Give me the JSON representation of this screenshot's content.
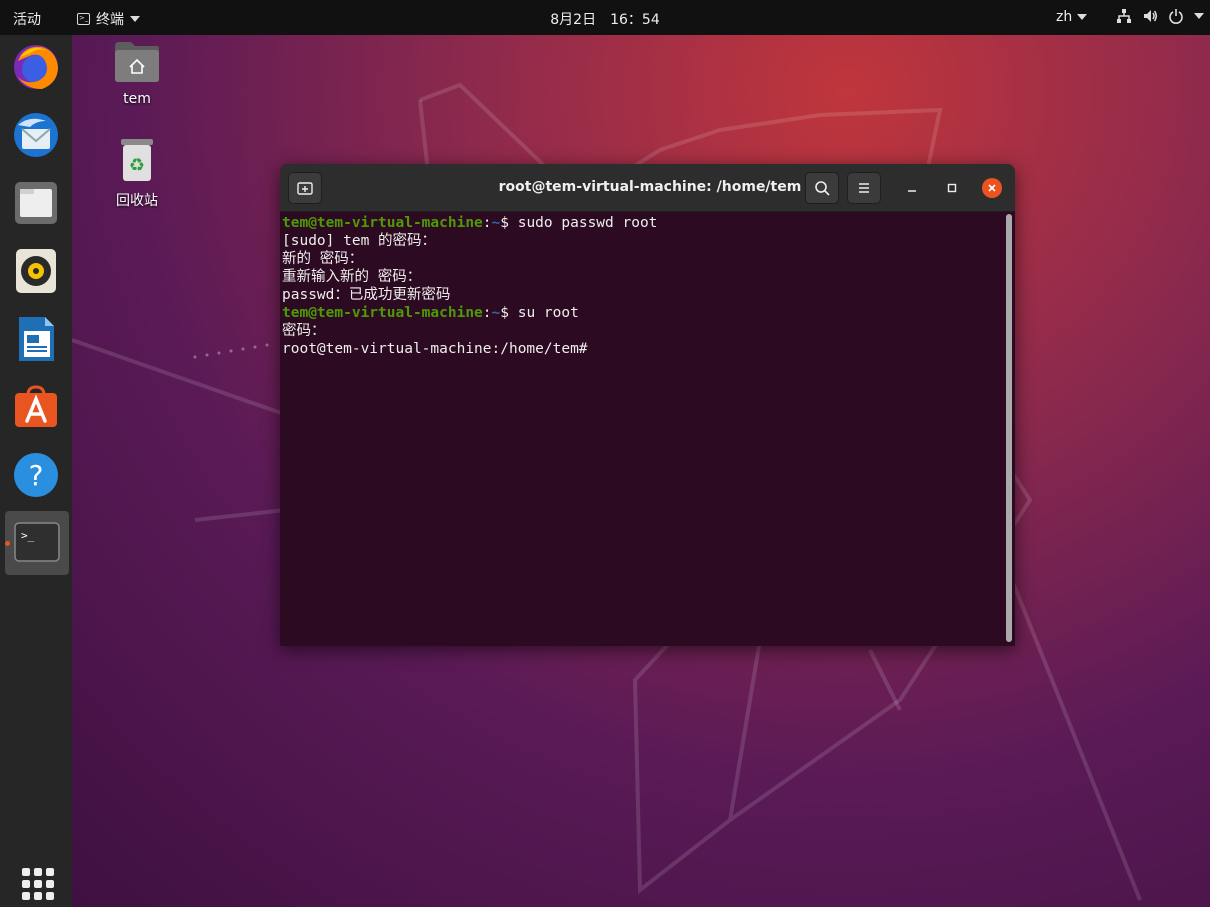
{
  "topbar": {
    "activities": "活动",
    "app_name": "终端",
    "clock_date": "8月2日",
    "clock_time": "16：54",
    "input_method": "zh"
  },
  "desktop": {
    "home_label": "tem",
    "trash_label": "回收站"
  },
  "dock": {
    "items": [
      "firefox-icon",
      "thunderbird-icon",
      "files-icon",
      "rhythmbox-icon",
      "libreoffice-writer-icon",
      "ubuntu-software-icon",
      "help-icon",
      "terminal-icon"
    ],
    "active": "terminal-icon"
  },
  "terminal": {
    "title": "root@tem-virtual-machine: /home/tem",
    "prompt_user": "tem@tem-virtual-machine",
    "prompt_path": "~",
    "cmd1": "$ sudo passwd root",
    "out1": "[sudo] tem 的密码：",
    "out2": "新的 密码：",
    "out3": "重新输入新的 密码：",
    "out4": "passwd：已成功更新密码",
    "cmd2": "$ su root",
    "out5": "密码：",
    "root_prompt": "root@tem-virtual-machine:/home/tem#"
  },
  "colors": {
    "accent": "#e95420",
    "terminal_bg": "#2c0a21",
    "prompt_green": "#4e9a06",
    "prompt_blue": "#3465a4"
  }
}
